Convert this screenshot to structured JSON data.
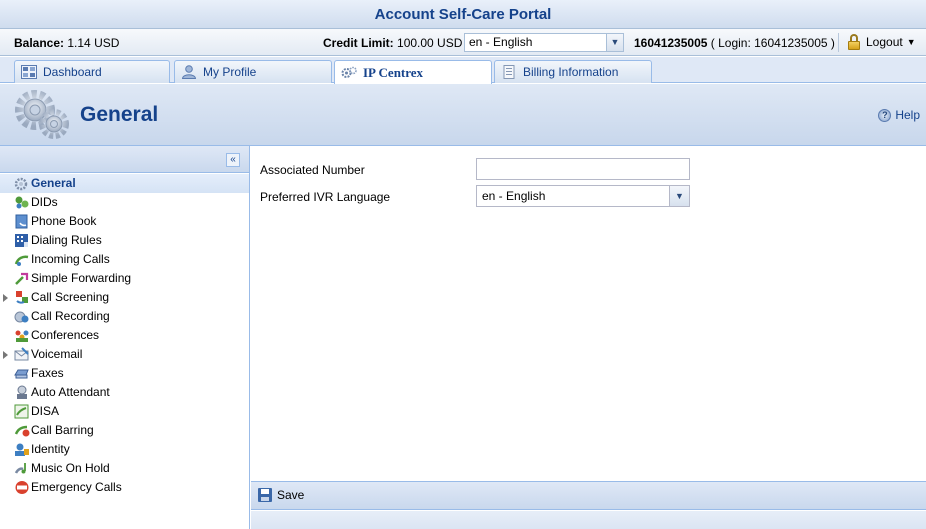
{
  "portal_title": "Account Self-Care Portal",
  "infobar": {
    "balance_label": "Balance:",
    "balance_value": "1.14 USD",
    "credit_label": "Credit Limit:",
    "credit_value": "100.00 USD",
    "language": "en - English",
    "account_number": "16041235005",
    "login_text": "( Login: 16041235005 )",
    "logout_label": "Logout"
  },
  "tabs": [
    {
      "label": "Dashboard"
    },
    {
      "label": "My Profile"
    },
    {
      "label": "IP Centrex"
    },
    {
      "label": "Billing Information"
    }
  ],
  "header": {
    "title": "General",
    "help_label": "Help"
  },
  "sidebar": {
    "items": [
      {
        "label": "General"
      },
      {
        "label": "DIDs"
      },
      {
        "label": "Phone Book"
      },
      {
        "label": "Dialing Rules"
      },
      {
        "label": "Incoming Calls"
      },
      {
        "label": "Simple Forwarding"
      },
      {
        "label": "Call Screening"
      },
      {
        "label": "Call Recording"
      },
      {
        "label": "Conferences"
      },
      {
        "label": "Voicemail"
      },
      {
        "label": "Faxes"
      },
      {
        "label": "Auto Attendant"
      },
      {
        "label": "DISA"
      },
      {
        "label": "Call Barring"
      },
      {
        "label": "Identity"
      },
      {
        "label": "Music On Hold"
      },
      {
        "label": "Emergency Calls"
      }
    ]
  },
  "form": {
    "associated_number_label": "Associated Number",
    "associated_number_value": "",
    "ivr_language_label": "Preferred IVR Language",
    "ivr_language_value": "en - English"
  },
  "toolbar": {
    "save_label": "Save"
  }
}
